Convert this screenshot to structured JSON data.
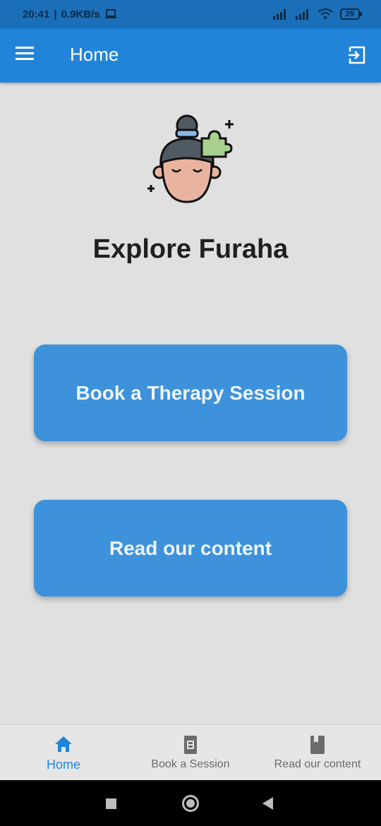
{
  "status_bar": {
    "time": "20:41",
    "speed": "0.9KB/s",
    "battery": "29"
  },
  "app_bar": {
    "title": "Home"
  },
  "main": {
    "title": "Explore Furaha",
    "buttons": [
      {
        "label": "Book a Therapy Session"
      },
      {
        "label": "Read our content"
      }
    ]
  },
  "bottom_nav": {
    "items": [
      {
        "label": "Home",
        "icon": "home-icon",
        "active": true
      },
      {
        "label": "Book a Session",
        "icon": "contacts-book-icon",
        "active": false
      },
      {
        "label": "Read our content",
        "icon": "book-icon",
        "active": false
      }
    ]
  },
  "colors": {
    "primary": "#2184d9",
    "button": "#3d92db",
    "background": "#e0e0e0"
  }
}
